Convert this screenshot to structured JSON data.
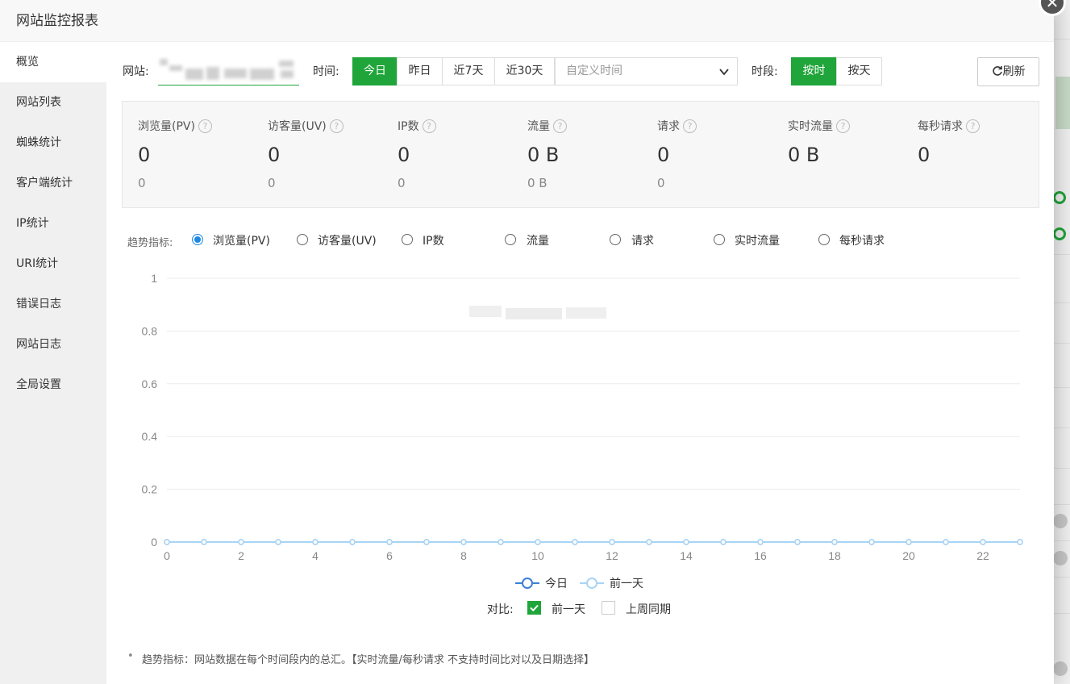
{
  "window": {
    "title": "网站监控报表",
    "close_glyph": "✕"
  },
  "sidebar": {
    "items": [
      {
        "label": "概览"
      },
      {
        "label": "网站列表"
      },
      {
        "label": "蜘蛛统计"
      },
      {
        "label": "客户端统计"
      },
      {
        "label": "IP统计"
      },
      {
        "label": "URI统计"
      },
      {
        "label": "错误日志"
      },
      {
        "label": "网站日志"
      },
      {
        "label": "全局设置"
      }
    ]
  },
  "toolbar": {
    "site_label": "网站:",
    "time_label": "时间:",
    "time_buttons": [
      "今日",
      "昨日",
      "近7天",
      "近30天"
    ],
    "date_placeholder": "自定义时间",
    "period_label": "时段:",
    "period_buttons": [
      "按时",
      "按天"
    ],
    "refresh_label": "刷新"
  },
  "stats": [
    {
      "title": "浏览量(PV)",
      "value": "0",
      "sub": "0"
    },
    {
      "title": "访客量(UV)",
      "value": "0",
      "sub": "0"
    },
    {
      "title": "IP数",
      "value": "0",
      "sub": "0"
    },
    {
      "title": "流量",
      "value": "0 B",
      "sub": "0 B"
    },
    {
      "title": "请求",
      "value": "0",
      "sub": "0"
    },
    {
      "title": "实时流量",
      "value": "0 B",
      "sub": ""
    },
    {
      "title": "每秒请求",
      "value": "0",
      "sub": ""
    }
  ],
  "trend": {
    "label": "趋势指标:",
    "options": [
      "浏览量(PV)",
      "访客量(UV)",
      "IP数",
      "流量",
      "请求",
      "实时流量",
      "每秒请求"
    ],
    "selected_index": 0
  },
  "chart_data": {
    "type": "line",
    "x": [
      0,
      1,
      2,
      3,
      4,
      5,
      6,
      7,
      8,
      9,
      10,
      11,
      12,
      13,
      14,
      15,
      16,
      17,
      18,
      19,
      20,
      21,
      22,
      23
    ],
    "xticks": [
      "0",
      "2",
      "4",
      "6",
      "8",
      "10",
      "12",
      "14",
      "16",
      "18",
      "20",
      "22"
    ],
    "ylim": [
      0,
      1
    ],
    "yticks": [
      "0",
      "0.2",
      "0.4",
      "0.6",
      "0.8",
      "1"
    ],
    "series": [
      {
        "name": "今日",
        "color": "#3c7fd8",
        "values": [
          0,
          0,
          0,
          0,
          0,
          0,
          0,
          0,
          0,
          0,
          0,
          0,
          0,
          0,
          0,
          0,
          0,
          0,
          0,
          0,
          0,
          0,
          0,
          0
        ]
      },
      {
        "name": "前一天",
        "color": "#a8d4f5",
        "values": [
          0,
          0,
          0,
          0,
          0,
          0,
          0,
          0,
          0,
          0,
          0,
          0,
          0,
          0,
          0,
          0,
          0,
          0,
          0,
          0,
          0,
          0,
          0,
          0
        ]
      }
    ],
    "grid": true,
    "legend": "bottom"
  },
  "compare": {
    "label": "对比:",
    "options": [
      {
        "label": "前一天",
        "checked": true
      },
      {
        "label": "上周同期",
        "checked": false
      }
    ]
  },
  "note": "趋势指标：网站数据在每个时间段内的总汇。【实时流量/每秒请求 不支持时间比对以及日期选择】",
  "colors": {
    "accent": "#20a53a",
    "radio": "#1e88e5"
  }
}
